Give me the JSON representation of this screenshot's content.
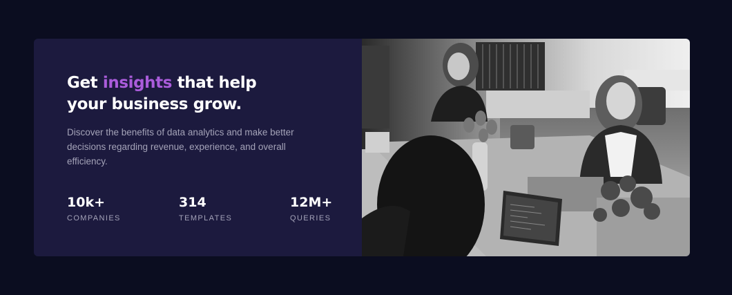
{
  "hero": {
    "headline_pre": "Get ",
    "headline_accent": "insights",
    "headline_post": " that help your business grow.",
    "description": "Discover the benefits of data analytics and make better decisions regarding revenue, experience, and overall efficiency."
  },
  "stats": [
    {
      "value": "10k+",
      "label": "COMPANIES"
    },
    {
      "value": "314",
      "label": "TEMPLATES"
    },
    {
      "value": "12M+",
      "label": "QUERIES"
    }
  ],
  "colors": {
    "page_background": "#0b0d20",
    "card_background": "#1c1a3e",
    "accent": "#aa5cdb",
    "muted_text": "#a4a3b8"
  },
  "photo": {
    "subject": "office-team-photo"
  }
}
